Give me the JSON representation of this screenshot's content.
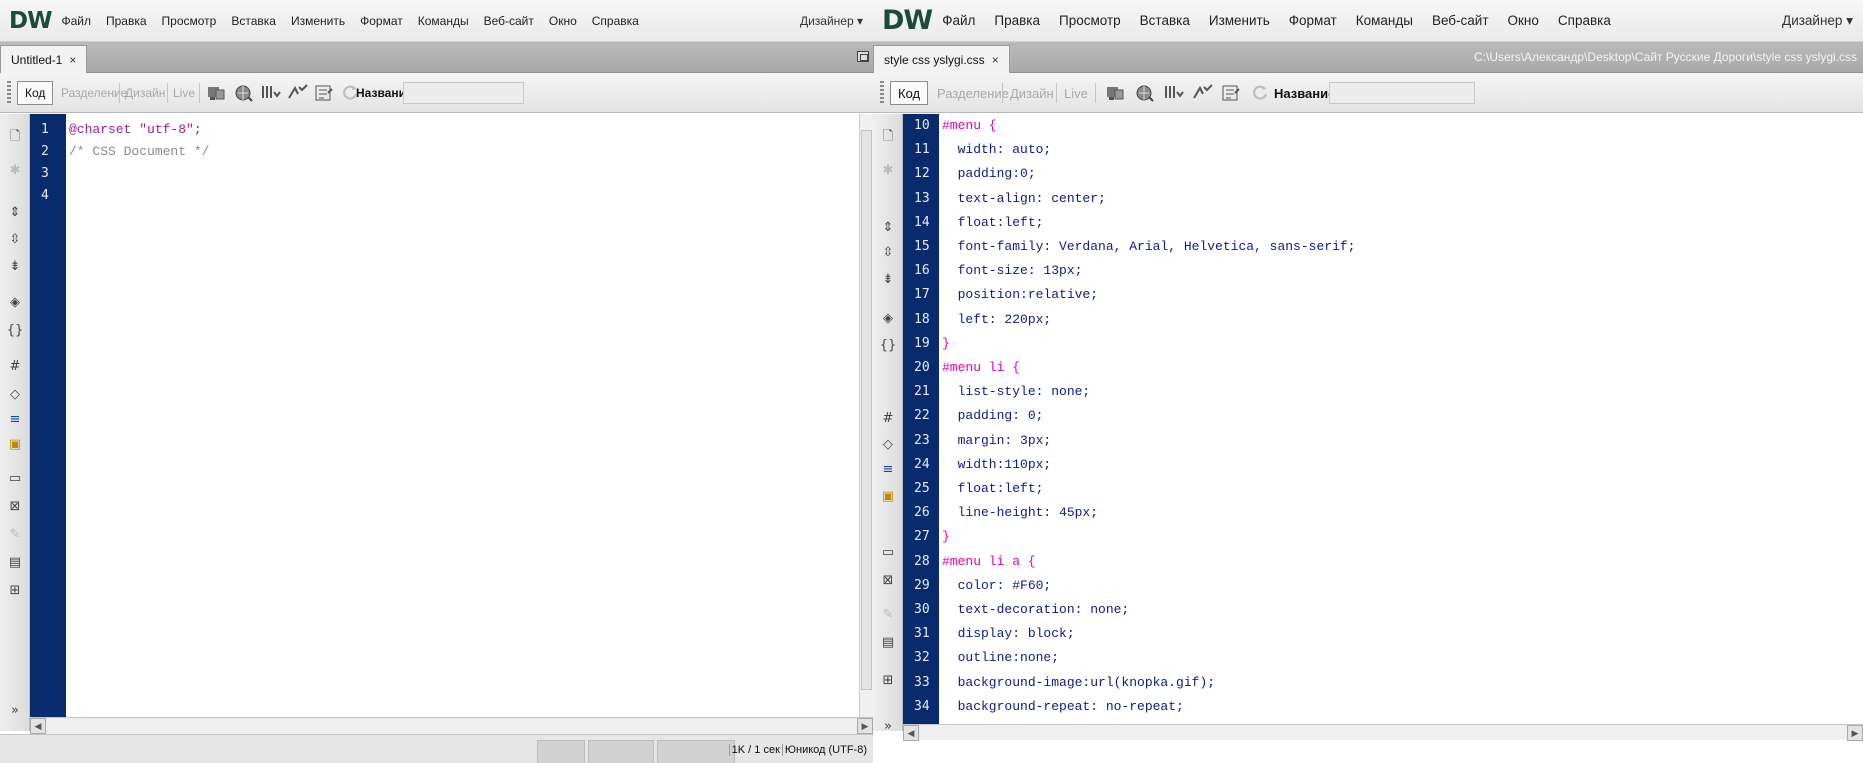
{
  "app": {
    "logo": "DW",
    "menu": [
      "Файл",
      "Правка",
      "Просмотр",
      "Вставка",
      "Изменить",
      "Формат",
      "Команды",
      "Веб-сайт",
      "Окно",
      "Справка"
    ],
    "workspace": "Дизайнер",
    "workspace_arrow": "▾"
  },
  "toolbar": {
    "code": "Код",
    "split": "Разделение",
    "design": "Дизайн",
    "live": "Live",
    "title_label": "Название:"
  },
  "left": {
    "tab_name": "Untitled-1",
    "tab_close": "×",
    "line_numbers": [
      "1",
      "2",
      "3",
      "4"
    ],
    "code_lines": [
      {
        "segments": [
          {
            "text": "@charset \"utf-8\";",
            "cls": "c-str"
          }
        ]
      },
      {
        "segments": [
          {
            "text": "/* CSS Document */",
            "cls": "c-comment"
          }
        ]
      },
      {
        "segments": []
      },
      {
        "segments": []
      }
    ],
    "status_size": "1K / 1 сек",
    "status_encoding": "Юникод (UTF-8)"
  },
  "right": {
    "tab_name": "style css yslygi.css",
    "tab_close": "×",
    "file_path": "C:\\Users\\Александр\\Desktop\\Сайт Русские Дороги\\style css yslygi.css",
    "line_numbers": [
      "10",
      "11",
      "12",
      "13",
      "14",
      "15",
      "16",
      "17",
      "18",
      "19",
      "20",
      "21",
      "22",
      "23",
      "24",
      "25",
      "26",
      "27",
      "28",
      "29",
      "30",
      "31",
      "32",
      "33",
      "34"
    ],
    "code_lines": [
      {
        "segments": [
          {
            "text": "#menu {",
            "cls": "c-sel"
          }
        ]
      },
      {
        "segments": [
          {
            "text": "  width: auto;",
            "cls": "c-prop"
          }
        ]
      },
      {
        "segments": [
          {
            "text": "  padding:0;",
            "cls": "c-prop"
          }
        ]
      },
      {
        "segments": [
          {
            "text": "  text-align: center;",
            "cls": "c-prop"
          }
        ]
      },
      {
        "segments": [
          {
            "text": "  float:left;",
            "cls": "c-prop"
          }
        ]
      },
      {
        "segments": [
          {
            "text": "  font-family: Verdana, Arial, Helvetica, sans-serif;",
            "cls": "c-prop"
          }
        ]
      },
      {
        "segments": [
          {
            "text": "  font-size: 13px;",
            "cls": "c-prop"
          }
        ]
      },
      {
        "segments": [
          {
            "text": "  position:relative;",
            "cls": "c-prop"
          }
        ]
      },
      {
        "segments": [
          {
            "text": "  left: 220px;",
            "cls": "c-prop"
          }
        ]
      },
      {
        "segments": [
          {
            "text": "}",
            "cls": "c-punc"
          }
        ]
      },
      {
        "segments": [
          {
            "text": "#menu li {",
            "cls": "c-sel"
          }
        ]
      },
      {
        "segments": [
          {
            "text": "  list-style: none;",
            "cls": "c-prop"
          }
        ]
      },
      {
        "segments": [
          {
            "text": "  padding: 0;",
            "cls": "c-prop"
          }
        ]
      },
      {
        "segments": [
          {
            "text": "  margin: 3px;",
            "cls": "c-prop"
          }
        ]
      },
      {
        "segments": [
          {
            "text": "  width:110px;",
            "cls": "c-prop"
          }
        ]
      },
      {
        "segments": [
          {
            "text": "  float:left;",
            "cls": "c-prop"
          }
        ]
      },
      {
        "segments": [
          {
            "text": "  line-height: 45px;",
            "cls": "c-prop"
          }
        ]
      },
      {
        "segments": [
          {
            "text": "}",
            "cls": "c-punc"
          }
        ]
      },
      {
        "segments": [
          {
            "text": "#menu li a {",
            "cls": "c-sel"
          }
        ]
      },
      {
        "segments": [
          {
            "text": "  color: #F60;",
            "cls": "c-prop"
          }
        ]
      },
      {
        "segments": [
          {
            "text": "  text-decoration: none;",
            "cls": "c-prop"
          }
        ]
      },
      {
        "segments": [
          {
            "text": "  display: block;",
            "cls": "c-prop"
          }
        ]
      },
      {
        "segments": [
          {
            "text": "  outline:none;",
            "cls": "c-prop"
          }
        ]
      },
      {
        "segments": [
          {
            "text": "  background-image:url(knopka.gif);",
            "cls": "c-prop"
          }
        ]
      },
      {
        "segments": [
          {
            "text": "  background-repeat: no-repeat;",
            "cls": "c-prop"
          }
        ]
      }
    ]
  },
  "icons": {
    "coding_toolbar": [
      "open-documents-icon",
      "show-code-navigator-icon",
      "collapse-full-tag-icon",
      "collapse-selection-icon",
      "expand-all-icon",
      "select-parent-tag-icon",
      "balance-braces-icon",
      "line-numbers-icon",
      "highlight-invalid-code-icon",
      "word-wrap-icon",
      "syntax-coloring-icon",
      "apply-comment-icon",
      "remove-comment-icon",
      "wrap-tag-icon",
      "recent-snippets-icon",
      "move-css-icon",
      "format-source-icon"
    ]
  }
}
